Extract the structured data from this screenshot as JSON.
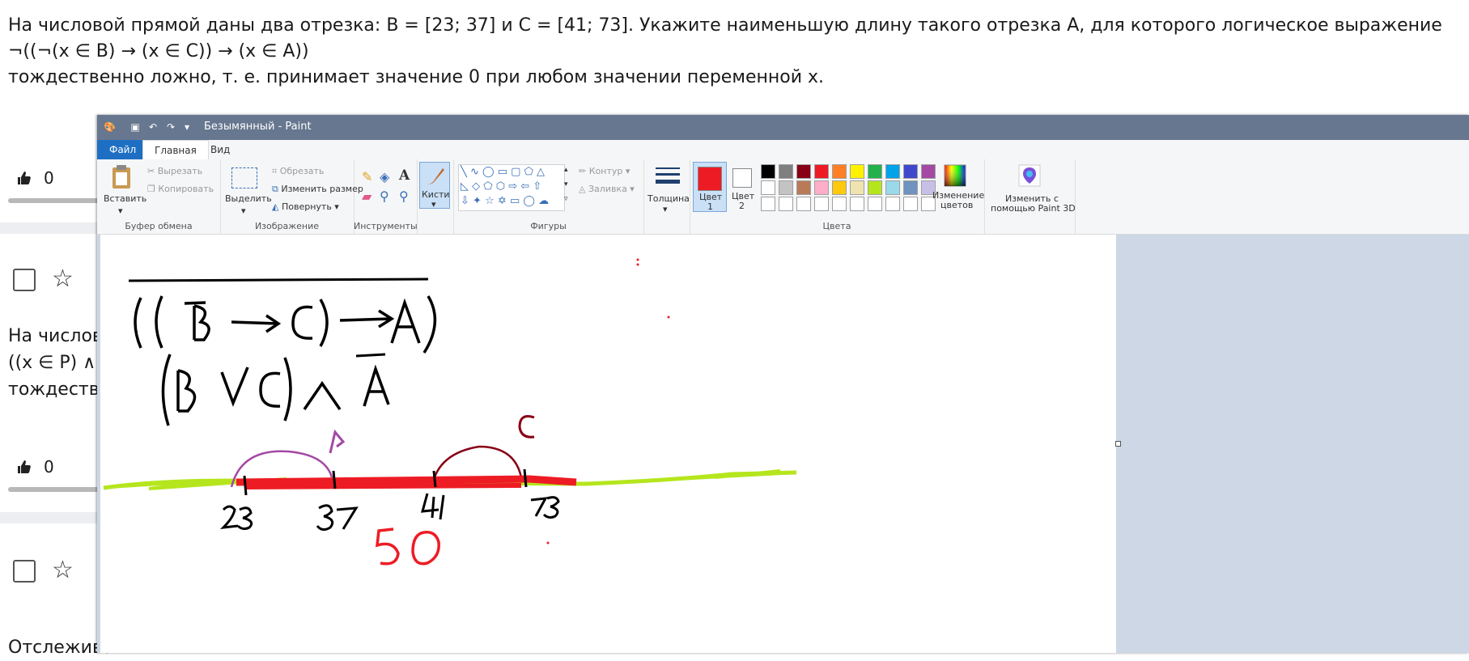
{
  "question": {
    "line1": "На числовой прямой даны два отрезка: B = [23; 37] и C = [41; 73]. Укажите наименьшую длину такого отрезка A, для которого логическое выражение",
    "line2": "¬((¬(x ∈ B) → (x ∈ C)) → (x ∈ A))",
    "line3": "тождественно ложно, т. е. принимает значение 0 при любом значении переменной x."
  },
  "background": {
    "likes_1": "0",
    "likes_2": "0",
    "partial_line1": "На числовой прямой",
    "partial_line2": "((x ∈ P) ∧ ¬",
    "partial_line3": "тождественно",
    "partial_bottom": "Отслеживать"
  },
  "paint": {
    "window_title": "Безымянный - Paint",
    "tabs": {
      "file": "Файл",
      "home": "Главная",
      "view": "Вид"
    },
    "clipboard": {
      "paste": "Вставить",
      "cut": "Вырезать",
      "copy": "Копировать",
      "label": "Буфер обмена"
    },
    "image": {
      "select": "Выделить",
      "crop": "Обрезать",
      "resize": "Изменить размер",
      "rotate": "Повернуть",
      "label": "Изображение"
    },
    "tools": {
      "label": "Инструменты"
    },
    "brushes": {
      "label": "Кисти"
    },
    "shapes": {
      "outline": "Контур",
      "fill": "Заливка",
      "label": "Фигуры"
    },
    "size": {
      "label": "Толщина"
    },
    "colors": {
      "color1_line1": "Цвет",
      "color1_line2": "1",
      "color2_line1": "Цвет",
      "color2_line2": "2",
      "edit_line1": "Изменение",
      "edit_line2": "цветов",
      "label": "Цвета",
      "color1": "#ed1c24",
      "color2": "#ffffff",
      "palette_row1": [
        "#000000",
        "#7f7f7f",
        "#880015",
        "#ed1c24",
        "#ff7f27",
        "#fff200",
        "#22b14c",
        "#00a2e8",
        "#3f48cc",
        "#a349a4"
      ],
      "palette_row2": [
        "#ffffff",
        "#c3c3c3",
        "#b97a57",
        "#ffaec9",
        "#ffc90e",
        "#efe4b0",
        "#b5e61d",
        "#99d9ea",
        "#7092be",
        "#c8bfe7"
      ]
    },
    "paint3d": {
      "line1": "Изменить с",
      "line2": "помощью Paint 3D"
    },
    "drawing": {
      "expr_bar_label": "B",
      "ticks": [
        "23",
        "37",
        "41",
        "73"
      ],
      "label_b": "B",
      "label_c": "C",
      "answer": "50"
    }
  }
}
